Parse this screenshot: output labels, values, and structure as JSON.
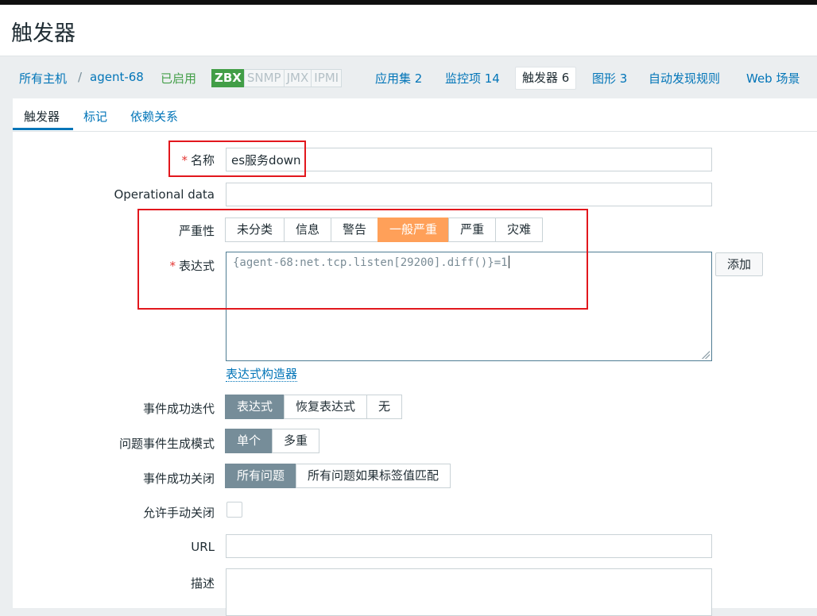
{
  "page": {
    "title": "触发器"
  },
  "hostnav": {
    "all_hosts": "所有主机",
    "separator": "/",
    "host": "agent-68",
    "status": "已启用",
    "badges": {
      "zbx": "ZBX",
      "snmp": "SNMP",
      "jmx": "JMX",
      "ipmi": "IPMI"
    },
    "applications": "应用集 2",
    "items": "监控项 14",
    "triggers": "触发器 6",
    "graphs": "图形 3",
    "discovery": "自动发现规则",
    "web": "Web 场景"
  },
  "subtabs": {
    "trigger": "触发器",
    "tags": "标记",
    "dependencies": "依赖关系"
  },
  "form": {
    "name": {
      "label": "名称",
      "value": "es服务down"
    },
    "opdata": {
      "label": "Operational data",
      "value": ""
    },
    "severity": {
      "label": "严重性",
      "options": [
        "未分类",
        "信息",
        "警告",
        "一般严重",
        "严重",
        "灾难"
      ],
      "selected": "一般严重"
    },
    "expression": {
      "label": "表达式",
      "value": "{agent-68:net.tcp.listen[29200].diff()}=1",
      "add_button": "添加",
      "builder_link": "表达式构造器"
    },
    "ok_event": {
      "label": "事件成功迭代",
      "options": [
        "表达式",
        "恢复表达式",
        "无"
      ],
      "selected": "表达式"
    },
    "problem_mode": {
      "label": "问题事件生成模式",
      "options": [
        "单个",
        "多重"
      ],
      "selected": "单个"
    },
    "ok_close": {
      "label": "事件成功关闭",
      "options": [
        "所有问题",
        "所有问题如果标签值匹配"
      ],
      "selected": "所有问题"
    },
    "manual_close": {
      "label": "允许手动关闭",
      "checked": false
    },
    "url": {
      "label": "URL",
      "value": ""
    },
    "description": {
      "label": "描述",
      "value": ""
    }
  },
  "colors": {
    "link": "#0275b8",
    "enabled": "#429e47",
    "selected_segment": "#768d99",
    "severity_average": "#ffa059",
    "required": "#e33734",
    "annotation_box": "#e2171d"
  }
}
